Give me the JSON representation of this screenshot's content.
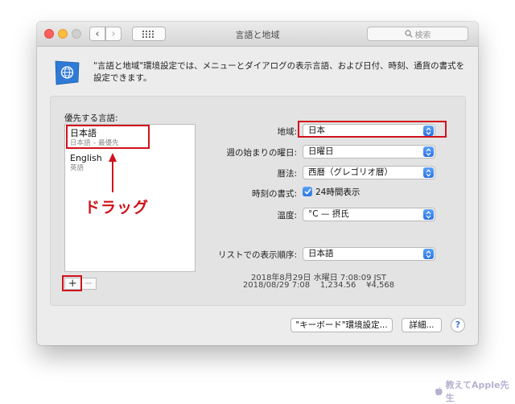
{
  "window": {
    "title": "言語と地域"
  },
  "search": {
    "placeholder": "検索"
  },
  "description": "\"言語と地域\"環境設定では、メニューとダイアログの表示言語、および日付、時刻、通貨の書式を設定できます。",
  "preferred": {
    "label": "優先する言語:",
    "languages": [
      {
        "name": "日本語",
        "sub": "日本語 – 最優先"
      },
      {
        "name": "English",
        "sub": "英語"
      }
    ],
    "add_label": "+",
    "remove_label": "−"
  },
  "annotation": {
    "drag_text": "ドラッグ"
  },
  "settings": {
    "region": {
      "label": "地域:",
      "value": "日本"
    },
    "first_day": {
      "label": "週の始まりの曜日:",
      "value": "日曜日"
    },
    "calendar": {
      "label": "暦法:",
      "value": "西暦（グレゴリオ暦）"
    },
    "time_format": {
      "label": "時刻の書式:",
      "check_label": "24時間表示",
      "checked": true
    },
    "temperature": {
      "label": "温度:",
      "value": "°C — 摂氏"
    },
    "list_order": {
      "label": "リストでの表示順序:",
      "value": "日本語"
    }
  },
  "samples": {
    "line1": "2018年8月29日 水曜日 7:08:09 JST",
    "line2": "2018/08/29 7:08    1,234.56    ¥4,568"
  },
  "buttons": {
    "keyboard": "\"キーボード\"環境設定...",
    "advanced": "詳細...",
    "help": "?"
  },
  "watermark": {
    "text": "教えてApple先生"
  },
  "colors": {
    "accent": "#2c74e3",
    "annotation_red": "#d1121b"
  }
}
